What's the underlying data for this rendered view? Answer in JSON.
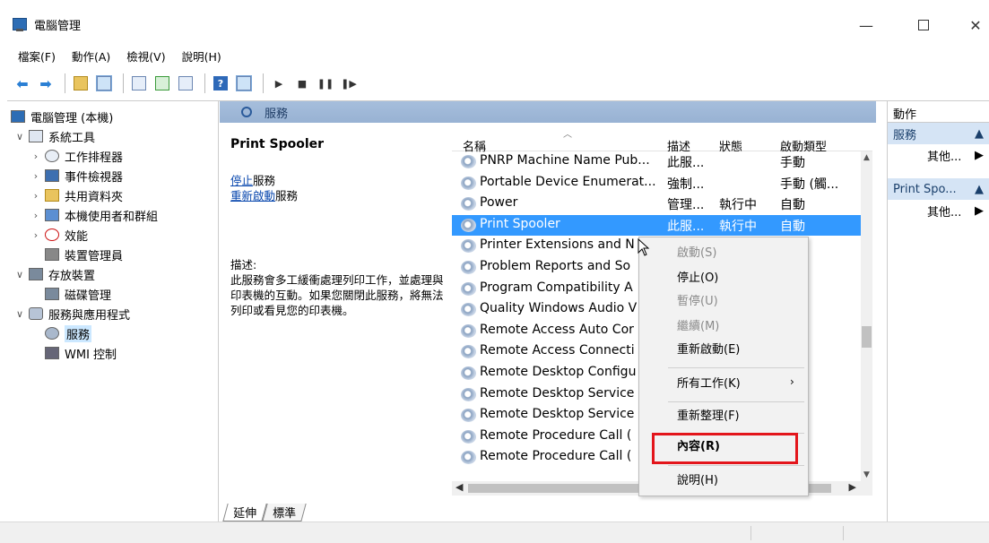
{
  "window": {
    "title": "電腦管理",
    "min": "—",
    "close": "✕"
  },
  "menu": {
    "file": "檔案(F)",
    "action": "動作(A)",
    "view": "檢視(V)",
    "help": "說明(H)"
  },
  "tree": {
    "root": "電腦管理 (本機)",
    "system_tools": "系統工具",
    "task_scheduler": "工作排程器",
    "event_viewer": "事件檢視器",
    "shared_folders": "共用資料夾",
    "local_users": "本機使用者和群組",
    "performance": "效能",
    "device_manager": "裝置管理員",
    "storage": "存放裝置",
    "disk_management": "磁碟管理",
    "services_apps": "服務與應用程式",
    "services": "服務",
    "wmi": "WMI 控制"
  },
  "header": {
    "title": "服務"
  },
  "details": {
    "service_name": "Print Spooler",
    "stop_link": "停止",
    "stop_suffix": "服務",
    "restart_link": "重新啟動",
    "restart_suffix": "服務",
    "desc_label": "描述:",
    "desc_text": "此服務會多工緩衝處理列印工作，並處理與印表機的互動。如果您關閉此服務，將無法列印或看見您的印表機。"
  },
  "columns": {
    "name": "名稱",
    "desc": "描述",
    "status": "狀態",
    "startup": "啟動類型"
  },
  "rows": [
    {
      "name": "PNRP Machine Name Pub...",
      "desc": "此服...",
      "status": "",
      "startup": "手動"
    },
    {
      "name": "Portable Device Enumerat...",
      "desc": "強制...",
      "status": "",
      "startup": "手動 (觸..."
    },
    {
      "name": "Power",
      "desc": "管理...",
      "status": "執行中",
      "startup": "自動"
    },
    {
      "name": "Print Spooler",
      "desc": "此服...",
      "status": "執行中",
      "startup": "自動"
    },
    {
      "name": "Printer Extensions and N",
      "desc": "",
      "status": "",
      "startup": ""
    },
    {
      "name": "Problem Reports and So",
      "desc": "",
      "status": "",
      "startup": ""
    },
    {
      "name": "Program Compatibility A",
      "desc": "",
      "status": "",
      "startup": ""
    },
    {
      "name": "Quality Windows Audio V",
      "desc": "",
      "status": "",
      "startup": ""
    },
    {
      "name": "Remote Access Auto Cor",
      "desc": "",
      "status": "",
      "startup": ""
    },
    {
      "name": "Remote Access Connecti",
      "desc": "",
      "status": "",
      "startup": ""
    },
    {
      "name": "Remote Desktop Configu",
      "desc": "",
      "status": "",
      "startup": ""
    },
    {
      "name": "Remote Desktop Service",
      "desc": "",
      "status": "",
      "startup": ""
    },
    {
      "name": "Remote Desktop Service",
      "desc": "",
      "status": "",
      "startup": ""
    },
    {
      "name": "Remote Procedure Call (",
      "desc": "",
      "status": "",
      "startup": ""
    },
    {
      "name": "Remote Procedure Call (",
      "desc": "",
      "status": "",
      "startup": ""
    }
  ],
  "tabs": {
    "extended": "延伸",
    "standard": "標準"
  },
  "actions": {
    "head": "動作",
    "sec1": "服務",
    "more1": "其他...",
    "sec2": "Print Spo...",
    "more2": "其他..."
  },
  "context_menu": {
    "start": "啟動(S)",
    "stop": "停止(O)",
    "pause": "暫停(U)",
    "resume": "繼續(M)",
    "restart": "重新啟動(E)",
    "all_tasks": "所有工作(K)",
    "refresh": "重新整理(F)",
    "properties": "內容(R)",
    "help": "說明(H)"
  },
  "colors": {
    "selection": "#3399ff",
    "highlight_box": "#e3151b",
    "header_band": "#a6bedc"
  }
}
